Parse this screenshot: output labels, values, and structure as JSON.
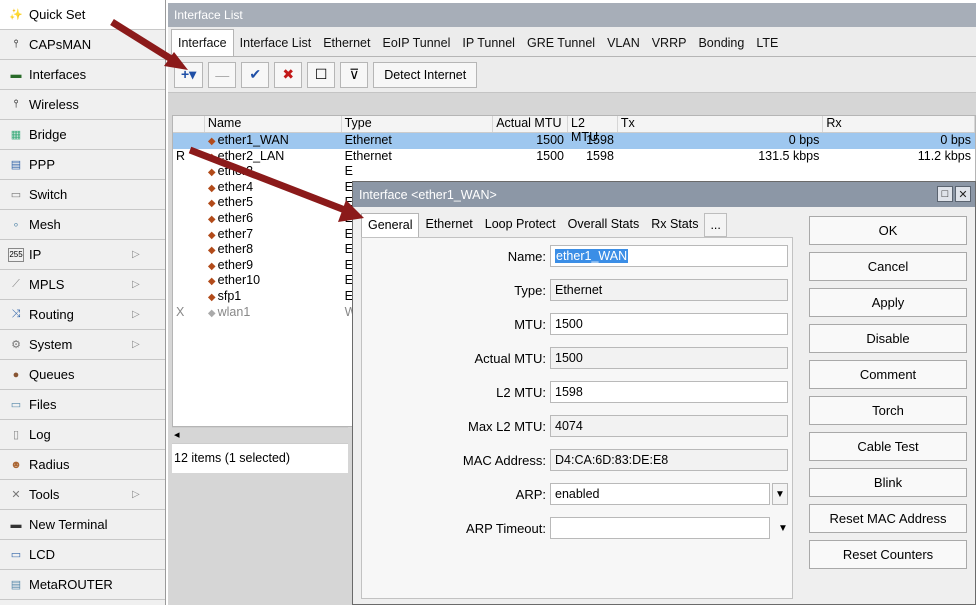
{
  "sidebar": {
    "items": [
      {
        "label": "Quick Set",
        "icon": "magic-wand-icon",
        "sub": false
      },
      {
        "label": "CAPsMAN",
        "icon": "antenna-icon",
        "sub": false
      },
      {
        "label": "Interfaces",
        "icon": "interfaces-icon",
        "sub": false
      },
      {
        "label": "Wireless",
        "icon": "antenna-icon",
        "sub": false
      },
      {
        "label": "Bridge",
        "icon": "bridge-icon",
        "sub": false
      },
      {
        "label": "PPP",
        "icon": "ppp-icon",
        "sub": false
      },
      {
        "label": "Switch",
        "icon": "switch-icon",
        "sub": false
      },
      {
        "label": "Mesh",
        "icon": "mesh-icon",
        "sub": false
      },
      {
        "label": "IP",
        "icon": "ip-icon",
        "sub": true
      },
      {
        "label": "MPLS",
        "icon": "mpls-icon",
        "sub": true
      },
      {
        "label": "Routing",
        "icon": "routing-icon",
        "sub": true
      },
      {
        "label": "System",
        "icon": "gear-icon",
        "sub": true
      },
      {
        "label": "Queues",
        "icon": "queues-icon",
        "sub": false
      },
      {
        "label": "Files",
        "icon": "folder-icon",
        "sub": false
      },
      {
        "label": "Log",
        "icon": "log-icon",
        "sub": false
      },
      {
        "label": "Radius",
        "icon": "radius-icon",
        "sub": false
      },
      {
        "label": "Tools",
        "icon": "tools-icon",
        "sub": true
      },
      {
        "label": "New Terminal",
        "icon": "terminal-icon",
        "sub": false
      },
      {
        "label": "LCD",
        "icon": "lcd-icon",
        "sub": false
      },
      {
        "label": "MetaROUTER",
        "icon": "metarouter-icon",
        "sub": false
      }
    ]
  },
  "window": {
    "title": "Interface List",
    "tabs": [
      "Interface",
      "Interface List",
      "Ethernet",
      "EoIP Tunnel",
      "IP Tunnel",
      "GRE Tunnel",
      "VLAN",
      "VRRP",
      "Bonding",
      "LTE"
    ],
    "toolbar": {
      "add": "+▾",
      "remove": "—",
      "enable": "✔",
      "disable": "✖",
      "comment": "☐",
      "filter": "⊽",
      "detect_internet": "Detect Internet"
    },
    "columns": [
      "",
      "Name",
      "Type",
      "Actual MTU",
      "L2 MTU",
      "Tx",
      "Rx"
    ],
    "rows": [
      {
        "flag": "",
        "name": "ether1_WAN",
        "type": "Ethernet",
        "mtu": "1500",
        "l2mtu": "1598",
        "tx": "0 bps",
        "rx": "0 bps",
        "selected": true
      },
      {
        "flag": "R",
        "name": "ether2_LAN",
        "type": "Ethernet",
        "mtu": "1500",
        "l2mtu": "1598",
        "tx": "131.5 kbps",
        "rx": "11.2 kbps"
      },
      {
        "flag": "",
        "name": "ether3",
        "type": "E",
        "mtu": "",
        "l2mtu": "",
        "tx": "",
        "rx": ""
      },
      {
        "flag": "",
        "name": "ether4",
        "type": "E",
        "mtu": "",
        "l2mtu": "",
        "tx": "",
        "rx": ""
      },
      {
        "flag": "",
        "name": "ether5",
        "type": "E",
        "mtu": "",
        "l2mtu": "",
        "tx": "",
        "rx": ""
      },
      {
        "flag": "",
        "name": "ether6",
        "type": "E",
        "mtu": "",
        "l2mtu": "",
        "tx": "",
        "rx": ""
      },
      {
        "flag": "",
        "name": "ether7",
        "type": "E",
        "mtu": "",
        "l2mtu": "",
        "tx": "",
        "rx": ""
      },
      {
        "flag": "",
        "name": "ether8",
        "type": "E",
        "mtu": "",
        "l2mtu": "",
        "tx": "",
        "rx": ""
      },
      {
        "flag": "",
        "name": "ether9",
        "type": "E",
        "mtu": "",
        "l2mtu": "",
        "tx": "",
        "rx": ""
      },
      {
        "flag": "",
        "name": "ether10",
        "type": "E",
        "mtu": "",
        "l2mtu": "",
        "tx": "",
        "rx": ""
      },
      {
        "flag": "",
        "name": "sfp1",
        "type": "E",
        "mtu": "",
        "l2mtu": "",
        "tx": "",
        "rx": ""
      },
      {
        "flag": "X",
        "name": "wlan1",
        "type": "W",
        "mtu": "",
        "l2mtu": "",
        "tx": "",
        "rx": "",
        "disabled": true
      }
    ],
    "scroll_left": "◂",
    "status": "12 items (1 selected)"
  },
  "dialog": {
    "title": "Interface <ether1_WAN>",
    "tabs": [
      "General",
      "Ethernet",
      "Loop Protect",
      "Overall Stats",
      "Rx Stats",
      "..."
    ],
    "fields": {
      "name_label": "Name:",
      "name_value": "ether1_WAN",
      "type_label": "Type:",
      "type_value": "Ethernet",
      "mtu_label": "MTU:",
      "mtu_value": "1500",
      "actual_mtu_label": "Actual MTU:",
      "actual_mtu_value": "1500",
      "l2mtu_label": "L2 MTU:",
      "l2mtu_value": "1598",
      "max_l2mtu_label": "Max L2 MTU:",
      "max_l2mtu_value": "4074",
      "mac_label": "MAC Address:",
      "mac_value": "D4:CA:6D:83:DE:E8",
      "arp_label": "ARP:",
      "arp_value": "enabled",
      "arp_timeout_label": "ARP Timeout:",
      "arp_timeout_value": ""
    },
    "buttons": [
      "OK",
      "Cancel",
      "Apply",
      "Disable",
      "Comment",
      "Torch",
      "Cable Test",
      "Blink",
      "Reset MAC Address",
      "Reset Counters"
    ]
  },
  "colors": {
    "annotation_arrow": "#8b1a1a",
    "selected_row": "#9ec7ef",
    "title_bar": "#8c97a6"
  }
}
